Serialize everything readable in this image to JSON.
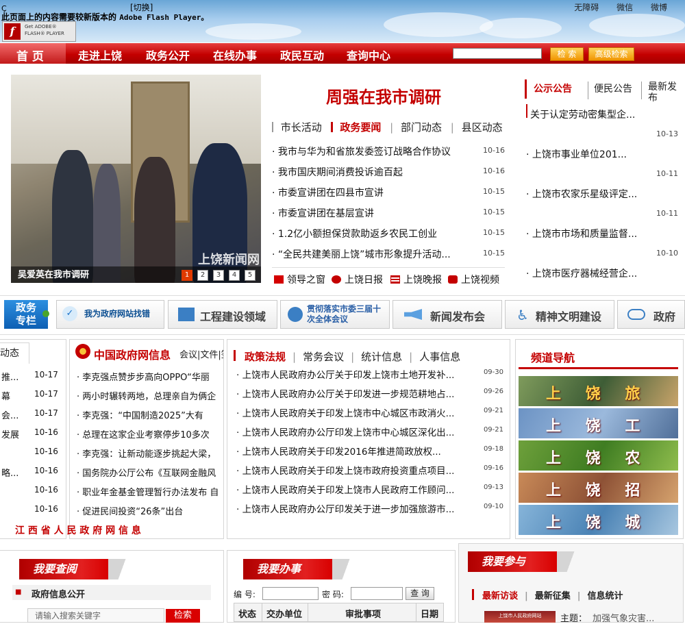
{
  "header": {
    "no_value": "Ҫ",
    "flash_notice": "此页面上的内容需要较新版本的",
    "flash_notice_mono": "Adobe Flash Player。",
    "switch_label": "[切换]",
    "get_flash_line1": "Get ADOBE®",
    "get_flash_line2": "FLASH® PLAYER",
    "top_links": [
      "无障碍",
      "微信",
      "微博"
    ]
  },
  "nav": {
    "items": [
      "首 页",
      "走进上饶",
      "政务公开",
      "在线办事",
      "政民互动",
      "查询中心"
    ],
    "search_button": "检 索",
    "advanced_search_button": "高级检索"
  },
  "feature": {
    "photo_caption": "吴爱英在我市调研",
    "watermark": "上饶新闻网",
    "pages": [
      "1",
      "2",
      "3",
      "4",
      "5"
    ],
    "headline": "周强在我市调研"
  },
  "news": {
    "tabs": [
      "市长活动",
      "政务要闻",
      "部门动态",
      "县区动态"
    ],
    "active_tab": "政务要闻",
    "items": [
      {
        "title": "我市与华为和省旅发委签订战略合作协议",
        "date": "10-16"
      },
      {
        "title": "我市国庆期间消费投诉逾百起",
        "date": "10-16"
      },
      {
        "title": "市委宣讲团在四县市宣讲",
        "date": "10-15"
      },
      {
        "title": "市委宣讲团在基层宣讲",
        "date": "10-15"
      },
      {
        "title": "1.2亿小额担保贷款助返乡农民工创业",
        "date": "10-15"
      },
      {
        "title": "“全民共建美丽上饶”城市形象提升活动...",
        "date": "10-15"
      }
    ],
    "media": [
      "领导之窗",
      "上饶日报",
      "上饶晚报",
      "上饶视频"
    ]
  },
  "notices": {
    "tabs": [
      "公示公告",
      "便民公告",
      "最新发布"
    ],
    "items": [
      {
        "title": "关于认定劳动密集型企...",
        "date": "10-13"
      },
      {
        "title": "上饶市事业单位201...",
        "date": "10-11"
      },
      {
        "title": "上饶市农家乐星级评定...",
        "date": "10-11"
      },
      {
        "title": "上饶市市场和质量监督...",
        "date": "10-10"
      },
      {
        "title": "上饶市医疗器械经营企..."
      }
    ]
  },
  "banners": {
    "zhuanlan_line1": "政务",
    "zhuanlan_line2": "专栏",
    "items": [
      "我为政府网站找错",
      "工程建设领域",
      "贯彻落实市委三届十次全体会议",
      "新闻发布会",
      "精神文明建设",
      "政府网"
    ]
  },
  "left_col": {
    "tab": "动态",
    "gov_title": "中国政府网信息",
    "gov_tabs": "会议|文件|签",
    "left_fragments": [
      "推...",
      "幕",
      "会...",
      "发展",
      "",
      "略...",
      "",
      ""
    ],
    "dates": [
      "10-17",
      "10-17",
      "10-17",
      "10-16",
      "10-16",
      "10-16",
      "10-16",
      "10-16"
    ],
    "items": [
      "李克强点赞步步高向OPPO“华丽",
      "两小时辗转两地，总理亲自为俩企",
      "李克强：“中国制造2025”大有",
      "总理在这家企业考察停步10多次",
      "李克强：让新动能逐步挑起大梁，",
      "国务院办公厅公布《互联网金融风",
      "职业年金基金管理暂行办法发布 自",
      "促进民间投资“26条”出台"
    ],
    "footer": "江 西 省 人 民 政 府 网 信 息"
  },
  "policy": {
    "tabs": [
      "政策法规",
      "常务会议",
      "统计信息",
      "人事信息"
    ],
    "items": [
      {
        "title": "上饶市人民政府办公厅关于印发上饶市土地开发补...",
        "date": "09-30"
      },
      {
        "title": "上饶市人民政府办公厅关于印发进一步规范耕地占...",
        "date": "09-26"
      },
      {
        "title": "上饶市人民政府关于印发上饶市中心城区市政消火...",
        "date": "09-21"
      },
      {
        "title": "上饶市人民政府办公厅印发上饶市中心城区深化出...",
        "date": "09-21"
      },
      {
        "title": "上饶市人民政府关于印发2016年推进简政放权...",
        "date": "09-18"
      },
      {
        "title": "上饶市人民政府关于印发上饶市政府投资重点项目...",
        "date": "09-16"
      },
      {
        "title": "上饶市人民政府关于印发上饶市人民政府工作顾问...",
        "date": "09-13"
      },
      {
        "title": "上饶市人民政府办公厅印发关于进一步加强旅游市...",
        "date": "09-10"
      }
    ]
  },
  "channels": {
    "title": "频道导航",
    "items": [
      "上 饶 旅 游",
      "上 饶 工 业",
      "上 饶 农 业",
      "上 饶 招 商",
      "上 饶 城 建"
    ]
  },
  "bottom": {
    "query": {
      "title": "我要查阅",
      "subtitle": "政府信息公开",
      "placeholder": "请输入搜索关键字",
      "button": "检索"
    },
    "handle": {
      "title": "我要办事",
      "no_label": "编 号:",
      "pwd_label": "密 码:",
      "button": "查 询",
      "cols": [
        "状态",
        "交办单位",
        "审批事项",
        "日期"
      ]
    },
    "participate": {
      "title": "我要参与",
      "tabs": [
        "最新访谈",
        "最新征集",
        "信息统计"
      ],
      "thumb_text": "上饶市人民政府网站",
      "topic_label": "主题：",
      "topic": "加强气象灾害..."
    }
  },
  "colors": {
    "brand_red": "#c40000",
    "nav_red": "#c40000",
    "button_orange": "#f09400"
  }
}
